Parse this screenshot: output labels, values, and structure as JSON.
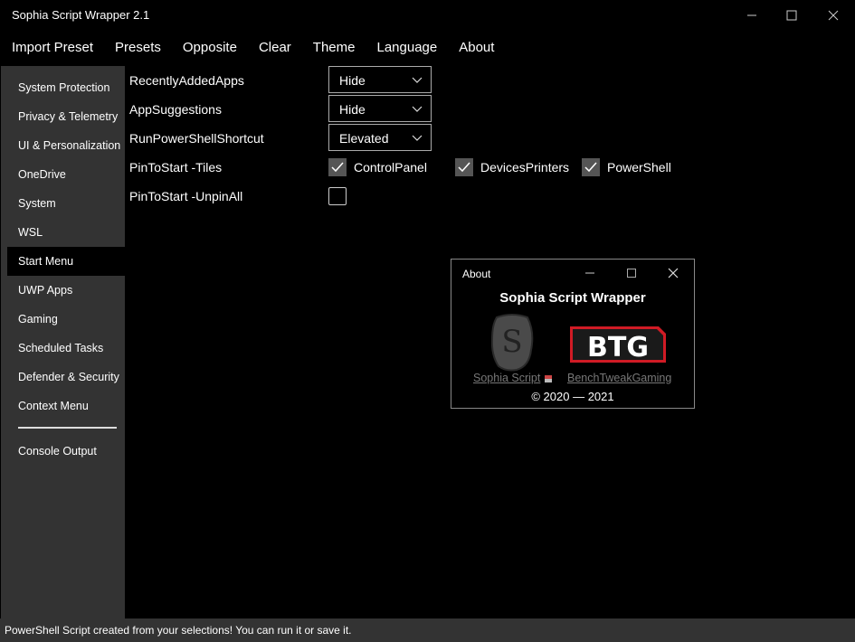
{
  "window": {
    "title": "Sophia Script Wrapper 2.1"
  },
  "menu": [
    "Import Preset",
    "Presets",
    "Opposite",
    "Clear",
    "Theme",
    "Language",
    "About"
  ],
  "sidebar": {
    "items": [
      {
        "label": "System Protection"
      },
      {
        "label": "Privacy & Telemetry"
      },
      {
        "label": "UI & Personalization"
      },
      {
        "label": "OneDrive"
      },
      {
        "label": "System"
      },
      {
        "label": "WSL"
      },
      {
        "label": "Start Menu",
        "active": true
      },
      {
        "label": "UWP Apps"
      },
      {
        "label": "Gaming"
      },
      {
        "label": "Scheduled Tasks"
      },
      {
        "label": "Defender & Security"
      },
      {
        "label": "Context Menu"
      }
    ],
    "console": "Console Output"
  },
  "settings": {
    "recently_added": {
      "label": "RecentlyAddedApps",
      "value": "Hide"
    },
    "app_suggestions": {
      "label": "AppSuggestions",
      "value": "Hide"
    },
    "run_ps_shortcut": {
      "label": "RunPowerShellShortcut",
      "value": "Elevated"
    },
    "pin_tiles": {
      "label": "PinToStart -Tiles",
      "options": [
        {
          "label": "ControlPanel",
          "checked": true
        },
        {
          "label": "DevicesPrinters",
          "checked": true
        },
        {
          "label": "PowerShell",
          "checked": true
        }
      ]
    },
    "unpin_all": {
      "label": "PinToStart -UnpinAll",
      "checked": false
    }
  },
  "about_dialog": {
    "title": "About",
    "app_name": "Sophia Script Wrapper",
    "logo_s_text": "S",
    "logo_btg_text": "BTG",
    "link_sophia": "Sophia Script",
    "link_btg": "BenchTweakGaming",
    "copyright": "© 2020 — 2021"
  },
  "status": {
    "text": "PowerShell Script created from your selections! You can run it or save it."
  },
  "colors": {
    "background": "#000000",
    "sidebar": "#333333",
    "accent_red": "#d01b25",
    "checkbox_fill": "#555555"
  }
}
